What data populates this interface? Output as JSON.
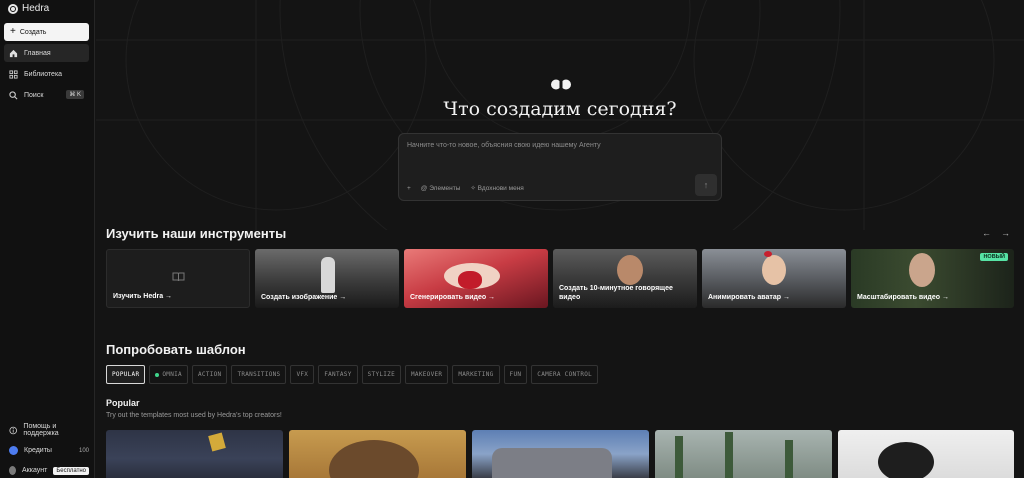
{
  "app": {
    "name": "Hedra"
  },
  "sidebar": {
    "create_label": "Создать",
    "items": [
      {
        "label": "Главная",
        "icon": "home-icon",
        "active": true
      },
      {
        "label": "Библиотека",
        "icon": "grid-icon",
        "active": false
      },
      {
        "label": "Поиск",
        "icon": "search-icon",
        "active": false,
        "shortcut": "⌘ K"
      }
    ],
    "bottom": {
      "help_label": "Помощь и поддержка",
      "credits_label": "Кредиты",
      "credits_value": "100",
      "account_label": "Аккаунт",
      "plan_label": "Бесплатно"
    }
  },
  "hero": {
    "title": "Что создадим сегодня?",
    "prompt_placeholder": "Начните что-то новое, объясния свою идею нашему Агенту",
    "elements_label": "Элементы",
    "inspire_label": "Вдохнови меня"
  },
  "tools": {
    "title": "Изучить наши инструменты",
    "cards": [
      {
        "label": "Изучить Hedra →"
      },
      {
        "label": "Создать изображение →"
      },
      {
        "label": "Сгенерировать видео →"
      },
      {
        "label": "Создать 10-минутное говорящее видео"
      },
      {
        "label": "Анимировать аватар →"
      },
      {
        "label": "Масштабировать видео →",
        "badge": "НОВЫЙ"
      }
    ]
  },
  "templates": {
    "title": "Попробовать шаблон",
    "tags": [
      "POPULAR",
      "OMNIA",
      "ACTION",
      "TRANSITIONS",
      "VFX",
      "FANTASY",
      "STYLIZE",
      "MAKEOVER",
      "MARKETING",
      "FUN",
      "CAMERA CONTROL"
    ],
    "active_tag": "POPULAR",
    "section_title": "Popular",
    "section_desc": "Try out the templates most used by Hedra's top creators!"
  },
  "colors": {
    "accent_new": "#57e3a5",
    "credits_dot": "#4d7cf0",
    "omnia_dot": "#3fd58b"
  }
}
